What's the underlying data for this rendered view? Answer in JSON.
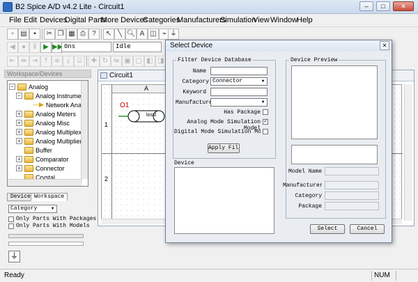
{
  "window": {
    "title": "B2 Spice A/D v4.2 Lite - Circuit1",
    "controls": [
      "–",
      "□",
      "✕"
    ]
  },
  "menu": [
    "File",
    "Edit",
    "Devices",
    "Digital Parts",
    "More Devices",
    "Categories",
    "Manufacturers",
    "Simulation",
    "View",
    "Window",
    "Help"
  ],
  "simulation_bar": {
    "time_value": "0ns",
    "state_value": "Idle"
  },
  "workspace": {
    "header": "Workspace/Devices",
    "tree": [
      {
        "label": "Analog",
        "expander": "−",
        "folder": true,
        "indent": 0
      },
      {
        "label": "Analog Instrumen",
        "expander": "−",
        "folder": true,
        "indent": 1
      },
      {
        "label": "Network Anal",
        "expander": "",
        "folder": false,
        "indent": 2
      },
      {
        "label": "Analog Meters",
        "expander": "+",
        "folder": true,
        "indent": 1
      },
      {
        "label": "Analog Misc",
        "expander": "+",
        "folder": true,
        "indent": 1
      },
      {
        "label": "Analog Multiplex",
        "expander": "+",
        "folder": true,
        "indent": 1
      },
      {
        "label": "Analog Multiplier",
        "expander": "+",
        "folder": true,
        "indent": 1
      },
      {
        "label": "Buffer",
        "expander": "",
        "folder": true,
        "indent": 1
      },
      {
        "label": "Comparator",
        "expander": "+",
        "folder": true,
        "indent": 1
      },
      {
        "label": "Connector",
        "expander": "+",
        "folder": true,
        "indent": 1
      },
      {
        "label": "Crystal",
        "expander": "",
        "folder": true,
        "indent": 1
      }
    ],
    "tabs": [
      "Devices",
      "Workspace"
    ],
    "active_tab": "Workspace",
    "category_select": "Category",
    "checkboxes": [
      {
        "label": "Only Parts With Packages",
        "checked": false
      },
      {
        "label": "Only Parts With Models",
        "checked": false
      }
    ]
  },
  "circuit": {
    "title": "Circuit1",
    "column_label": "A",
    "row_labels": [
      "1",
      "2"
    ],
    "part_label": "O1",
    "part_tag": "lossl"
  },
  "dialog": {
    "title": "Select Device",
    "close": "✕",
    "filter_group": "Filter Device Database",
    "fields": {
      "name_label": "Name",
      "name_value": "",
      "category_label": "Category",
      "category_value": "Connector",
      "keyword_label": "Keyword",
      "keyword_value": "",
      "manufacturer_label": "Manufacture",
      "manufacturer_value": ""
    },
    "checks": [
      {
        "label": "Has Package",
        "checked": false
      },
      {
        "label": "Analog Mode Simulation Model",
        "checked": true
      },
      {
        "label": "Digital Mode Simulation Model",
        "checked": false
      }
    ],
    "apply_button": "Apply Filter",
    "device_group": "Device",
    "preview_group": "Device Preview",
    "info": {
      "model_name_label": "Model Name",
      "manufacturer_label": "Manufacturer",
      "category_label": "Category",
      "package_label": "Package"
    },
    "select_button": "Select",
    "cancel_button": "Cancel"
  },
  "status": {
    "left": "Ready",
    "right": "NUM"
  },
  "colors": {
    "accent": "#2e6bbf",
    "part_label": "#d40000",
    "dialog_bg": "#e9edf2"
  }
}
